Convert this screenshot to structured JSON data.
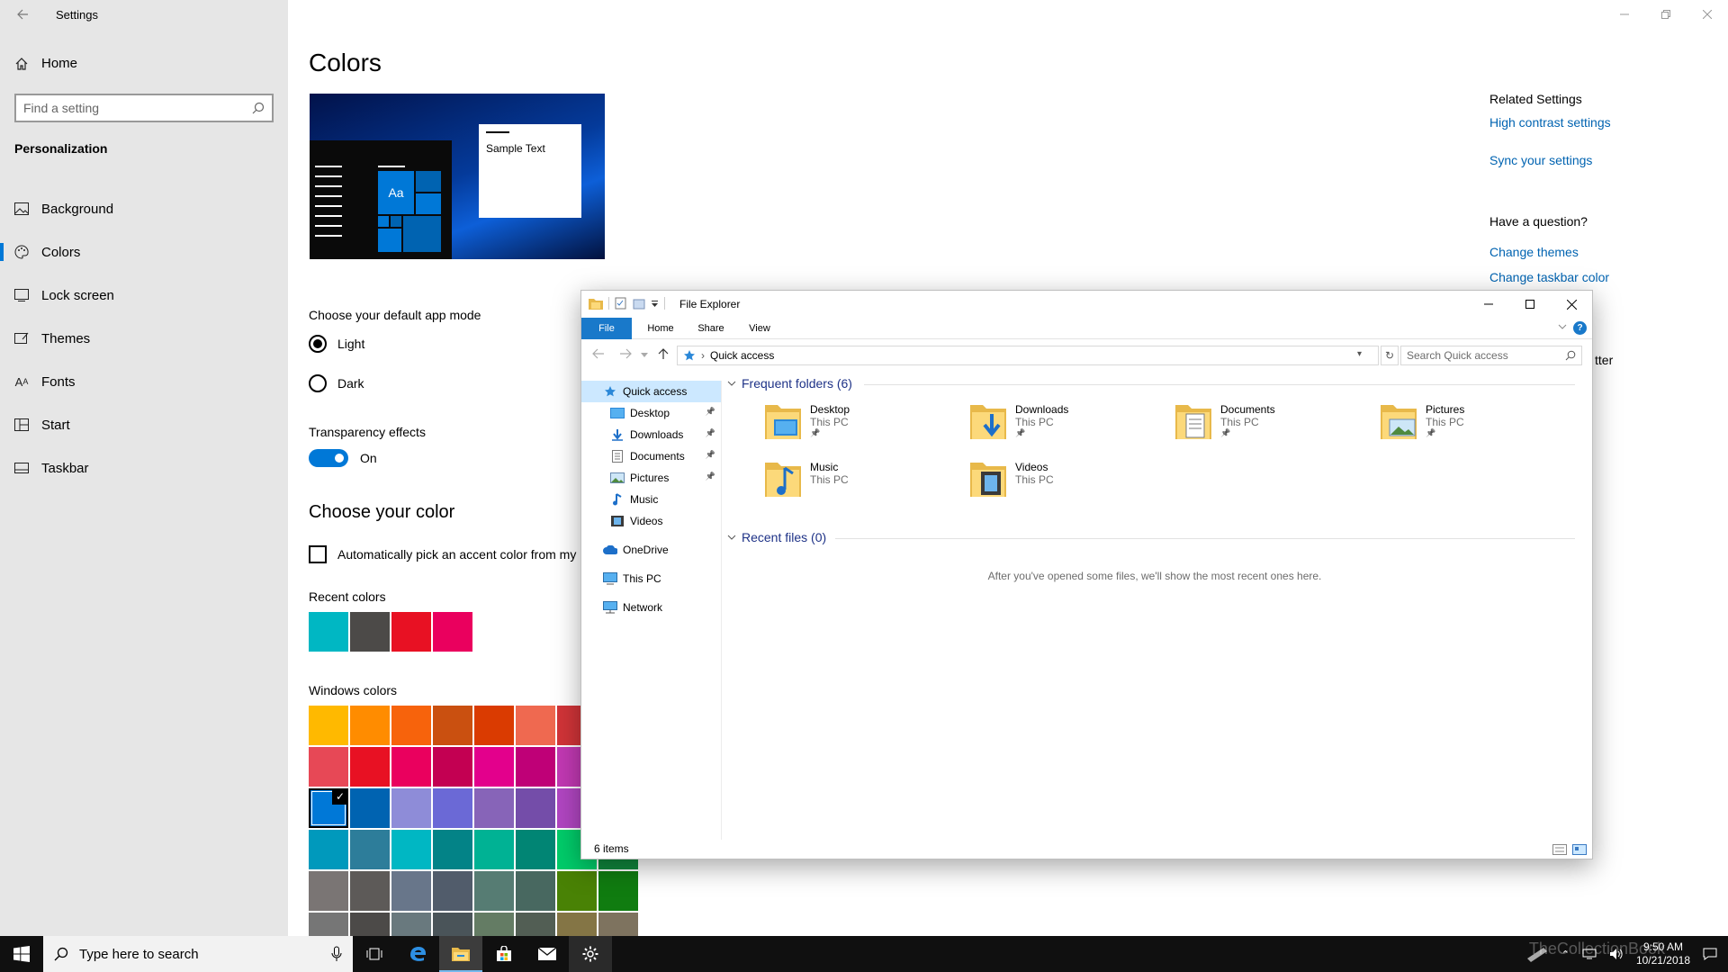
{
  "settings": {
    "title": "Settings",
    "home_label": "Home",
    "search_placeholder": "Find a setting",
    "section_label": "Personalization",
    "nav": [
      {
        "label": "Background",
        "icon": "picture-icon"
      },
      {
        "label": "Colors",
        "icon": "palette-icon",
        "active": true
      },
      {
        "label": "Lock screen",
        "icon": "lock-screen-icon"
      },
      {
        "label": "Themes",
        "icon": "themes-icon"
      },
      {
        "label": "Fonts",
        "icon": "fonts-icon"
      },
      {
        "label": "Start",
        "icon": "start-icon"
      },
      {
        "label": "Taskbar",
        "icon": "taskbar-icon"
      }
    ],
    "page_title": "Colors",
    "preview": {
      "aa": "Aa",
      "sample_text": "Sample Text"
    },
    "app_mode_label": "Choose your default app mode",
    "mode_light": "Light",
    "mode_dark": "Dark",
    "transparency_label": "Transparency effects",
    "transparency_state": "On",
    "choose_color_heading": "Choose your color",
    "auto_pick_label": "Automatically pick an accent color from my b",
    "recent_colors_label": "Recent colors",
    "recent_colors": [
      "#00b7c3",
      "#4c4a48",
      "#e81123",
      "#ea005e"
    ],
    "windows_colors_label": "Windows colors",
    "windows_colors": [
      [
        "#ffb900",
        "#ff8c00",
        "#f7630c",
        "#ca5010",
        "#da3b01",
        "#ef6950",
        "#d13438"
      ],
      [
        "#e74856",
        "#e81123",
        "#ea005e",
        "#c30052",
        "#e3008c",
        "#bf0077",
        "#c239b3"
      ],
      [
        "#0078d7",
        "#0063b1",
        "#8e8cd8",
        "#6b69d6",
        "#8764b8",
        "#744da9",
        "#b146c2"
      ],
      [
        "#0099bc",
        "#2d7d9a",
        "#00b7c3",
        "#038387",
        "#00b294",
        "#018574",
        "#00cc6a",
        "#10893e"
      ],
      [
        "#7a7574",
        "#5d5a58",
        "#68768a",
        "#515c6b",
        "#567c73",
        "#486860",
        "#498205",
        "#107c10"
      ],
      [
        "#767676",
        "#4c4a48",
        "#69797e",
        "#4a5459",
        "#647c64",
        "#525e54",
        "#847545",
        "#7e735f"
      ]
    ],
    "selected_color": "#0078d7",
    "related_heading": "Related Settings",
    "related_links": [
      "High contrast settings",
      "Sync your settings"
    ],
    "question_heading": "Have a question?",
    "question_links": [
      "Change themes",
      "Change taskbar color"
    ],
    "partial_text": "tter"
  },
  "explorer": {
    "title": "File Explorer",
    "tabs": [
      "File",
      "Home",
      "Share",
      "View"
    ],
    "address": "Quick access",
    "search_placeholder": "Search Quick access",
    "tree": [
      {
        "label": "Quick access",
        "icon": "star-icon",
        "selected": true,
        "indent": 0
      },
      {
        "label": "Desktop",
        "icon": "desktop-icon",
        "pinned": true,
        "indent": 1
      },
      {
        "label": "Downloads",
        "icon": "downloads-icon",
        "pinned": true,
        "indent": 1
      },
      {
        "label": "Documents",
        "icon": "documents-icon",
        "pinned": true,
        "indent": 1
      },
      {
        "label": "Pictures",
        "icon": "pictures-icon",
        "pinned": true,
        "indent": 1
      },
      {
        "label": "Music",
        "icon": "music-icon",
        "indent": 1
      },
      {
        "label": "Videos",
        "icon": "videos-icon",
        "indent": 1
      },
      {
        "label": "OneDrive",
        "icon": "cloud-icon",
        "indent": 0
      },
      {
        "label": "This PC",
        "icon": "pc-icon",
        "indent": 0
      },
      {
        "label": "Network",
        "icon": "network-icon",
        "indent": 0
      }
    ],
    "frequent_heading": "Frequent folders (6)",
    "folders": [
      {
        "name": "Desktop",
        "sub": "This PC",
        "pinned": true,
        "icon": "desktop-folder-icon"
      },
      {
        "name": "Downloads",
        "sub": "This PC",
        "pinned": true,
        "icon": "downloads-folder-icon"
      },
      {
        "name": "Documents",
        "sub": "This PC",
        "pinned": true,
        "icon": "documents-folder-icon"
      },
      {
        "name": "Pictures",
        "sub": "This PC",
        "pinned": true,
        "icon": "pictures-folder-icon"
      },
      {
        "name": "Music",
        "sub": "This PC",
        "pinned": false,
        "icon": "music-folder-icon"
      },
      {
        "name": "Videos",
        "sub": "This PC",
        "pinned": false,
        "icon": "videos-folder-icon"
      }
    ],
    "recent_heading": "Recent files (0)",
    "empty_message": "After you've opened some files, we'll show the most recent ones here.",
    "status": "6 items"
  },
  "taskbar": {
    "search_placeholder": "Type here to search",
    "time": "9:50 AM",
    "date": "10/21/2018",
    "watermark": "TheCollectionBook"
  }
}
